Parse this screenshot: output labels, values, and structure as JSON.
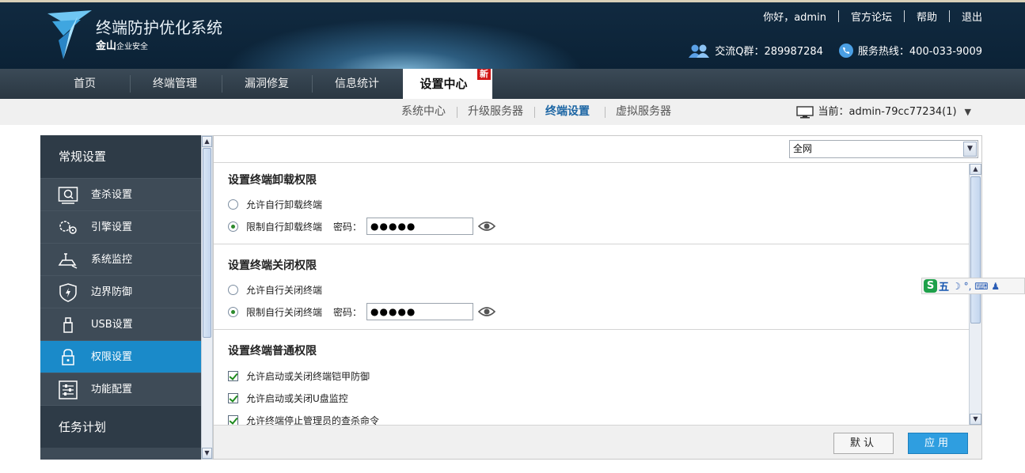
{
  "header": {
    "title": "终端防护优化系统",
    "brand": "金山",
    "brand_suffix": "企业安全",
    "greeting": "你好，admin",
    "links": [
      "官方论坛",
      "帮助",
      "退出"
    ],
    "qq_group": "交流Q群：289987284",
    "hotline": "服务热线：400-033-9009"
  },
  "nav": {
    "items": [
      "首页",
      "终端管理",
      "漏洞修复",
      "信息统计",
      "设置中心"
    ],
    "active": "设置中心",
    "badge": "新"
  },
  "subnav": {
    "items": [
      "系统中心",
      "升级服务器",
      "终端设置",
      "虚拟服务器"
    ],
    "active": "终端设置",
    "current": "当前：admin-79cc77234(1)"
  },
  "sidebar": {
    "group1": "常规设置",
    "items": [
      {
        "label": "查杀设置",
        "icon": "scan-icon"
      },
      {
        "label": "引擎设置",
        "icon": "engine-icon"
      },
      {
        "label": "系统监控",
        "icon": "monitor-icon"
      },
      {
        "label": "边界防御",
        "icon": "shield-icon"
      },
      {
        "label": "USB设置",
        "icon": "usb-icon"
      },
      {
        "label": "权限设置",
        "icon": "lock-icon"
      },
      {
        "label": "功能配置",
        "icon": "sliders-icon"
      }
    ],
    "active": "权限设置",
    "group2": "任务计划"
  },
  "content": {
    "scope": "全网",
    "uninstall": {
      "title": "设置终端卸载权限",
      "allow": "允许自行卸载终端",
      "restrict": "限制自行卸载终端",
      "pwd_label": "密码：",
      "pwd_value": "●●●●●",
      "selected": "restrict"
    },
    "shutdown": {
      "title": "设置终端关闭权限",
      "allow": "允许自行关闭终端",
      "restrict": "限制自行关闭终端",
      "pwd_label": "密码：",
      "pwd_value": "●●●●●",
      "selected": "restrict"
    },
    "general": {
      "title": "设置终端普通权限",
      "options": [
        {
          "label": "允许启动或关闭终端铠甲防御",
          "checked": true
        },
        {
          "label": "允许启动或关闭U盘监控",
          "checked": true
        },
        {
          "label": "允许终端停止管理员的查杀命令",
          "checked": true
        }
      ]
    },
    "buttons": {
      "default": "默认",
      "apply": "应用"
    }
  },
  "ime": {
    "mode": "五",
    "symbols": "☽ °, ⌨ ♟"
  },
  "colors": {
    "accent": "#1a8ac9",
    "apply": "#2f9ee0",
    "header": "#0b2236",
    "sidebar": "#3e4b57"
  }
}
